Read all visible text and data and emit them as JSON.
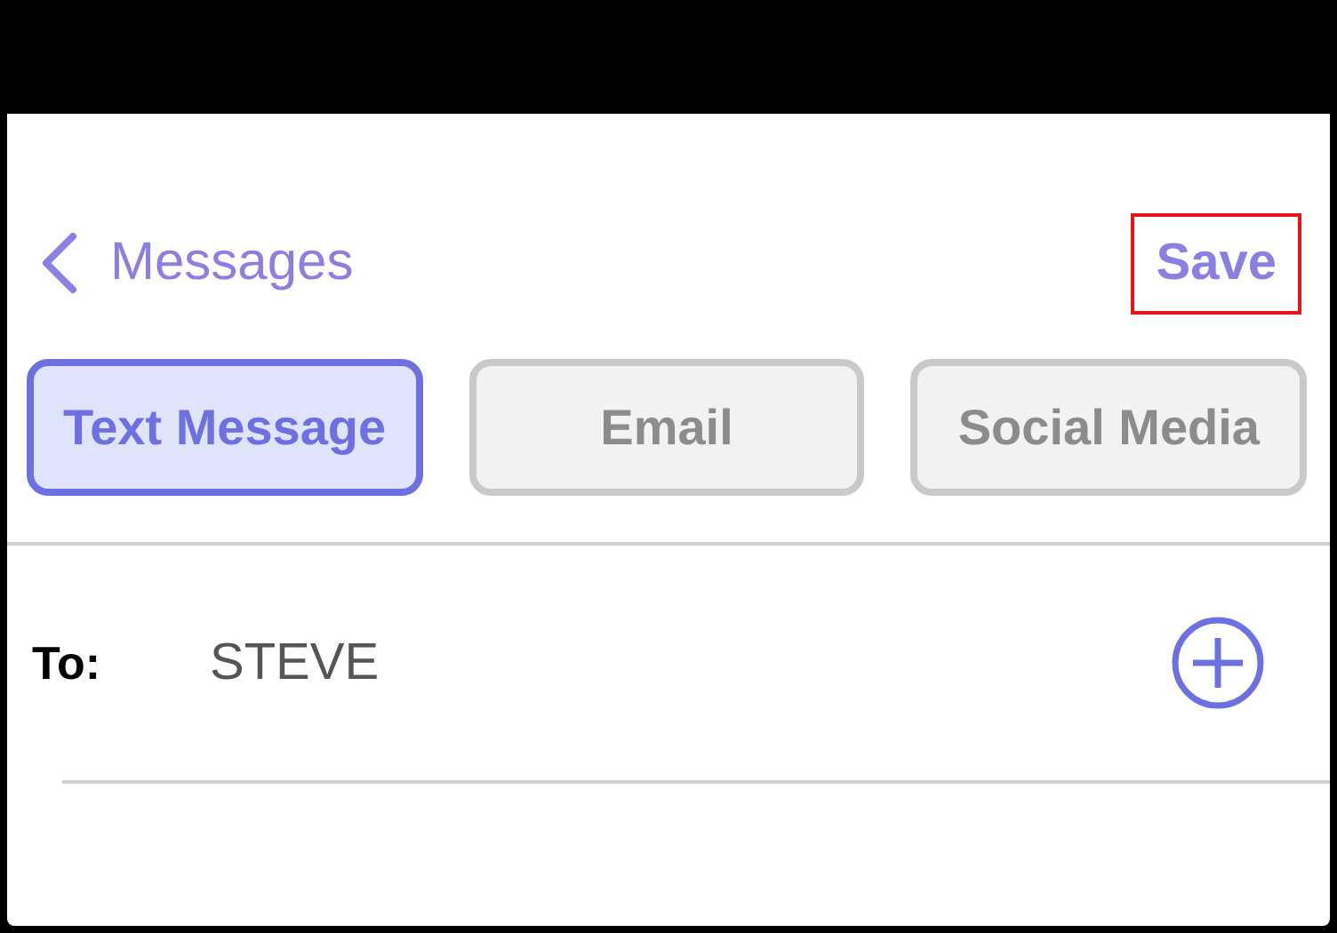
{
  "nav": {
    "back_label": "Messages",
    "save": {
      "label": "Save",
      "highlighted": true
    }
  },
  "tabs": [
    {
      "label": "Text Message",
      "selected": true
    },
    {
      "label": "Email",
      "selected": false
    },
    {
      "label": "Social Media",
      "selected": false
    }
  ],
  "recipient": {
    "label": "To:",
    "value": "STEVE"
  }
}
